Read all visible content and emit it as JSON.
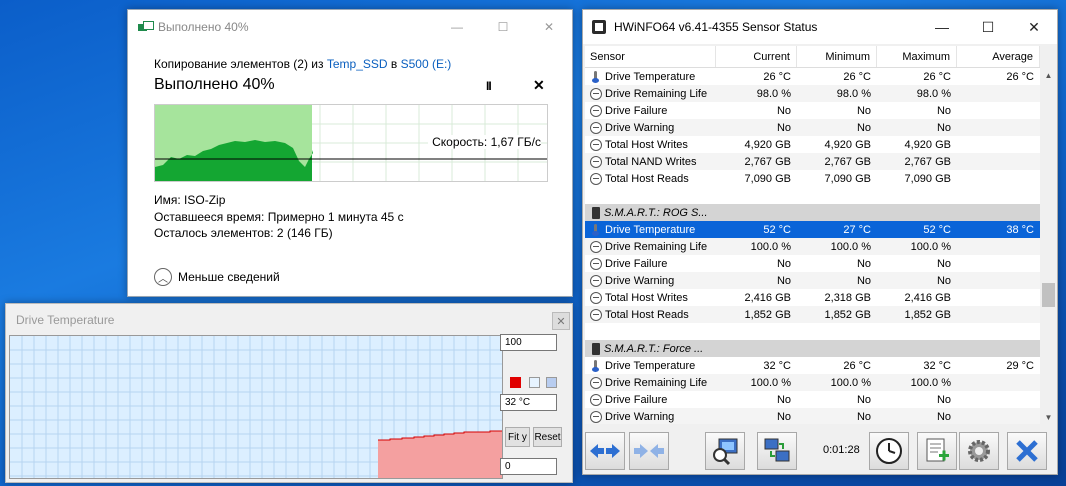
{
  "copy_dialog": {
    "title": "Выполнено 40%",
    "line_prefix": "Копирование элементов (2) из",
    "source": "Temp_SSD",
    "line_mid": "в",
    "dest": "S500 (E:)",
    "heading": "Выполнено 40%",
    "progress_fraction": 0.4,
    "speed": "Скорость: 1,67 ГБ/с",
    "name_line": "Имя:  ISO-Zip",
    "time_line": "Оставшееся время:  Примерно 1 минута 45 с",
    "items_line": "Осталось элементов:  2 (146 ГБ)",
    "less_details": "Меньше сведений",
    "pause_glyph": "II",
    "close_glyph": "✕",
    "accent": "#06b025"
  },
  "temp_graph": {
    "title": "Drive Temperature",
    "max_value": "100",
    "current_value": "32 °C",
    "min_value": "0",
    "fit_label": "Fit y",
    "reset_label": "Reset",
    "fill_color": "#f4a0a0",
    "line_color": "#d60000"
  },
  "hwinfo": {
    "title": "HWiNFO64 v6.41-4355 Sensor Status",
    "columns": [
      "Sensor",
      "Current",
      "Minimum",
      "Maximum",
      "Average"
    ],
    "rows": [
      {
        "type": "thermo",
        "name": "Drive Temperature",
        "cur": "26 °C",
        "min": "26 °C",
        "max": "26 °C",
        "avg": "26 °C"
      },
      {
        "type": "circle",
        "name": "Drive Remaining Life",
        "cur": "98.0 %",
        "min": "98.0 %",
        "max": "98.0 %",
        "avg": ""
      },
      {
        "type": "circle",
        "name": "Drive Failure",
        "cur": "No",
        "min": "No",
        "max": "No",
        "avg": ""
      },
      {
        "type": "circle",
        "name": "Drive Warning",
        "cur": "No",
        "min": "No",
        "max": "No",
        "avg": ""
      },
      {
        "type": "circle",
        "name": "Total Host Writes",
        "cur": "4,920 GB",
        "min": "4,920 GB",
        "max": "4,920 GB",
        "avg": ""
      },
      {
        "type": "circle",
        "name": "Total NAND Writes",
        "cur": "2,767 GB",
        "min": "2,767 GB",
        "max": "2,767 GB",
        "avg": ""
      },
      {
        "type": "circle",
        "name": "Total Host Reads",
        "cur": "7,090 GB",
        "min": "7,090 GB",
        "max": "7,090 GB",
        "avg": ""
      },
      {
        "type": "blank"
      },
      {
        "type": "group",
        "name": "S.M.A.R.T.: ROG S..."
      },
      {
        "type": "thermo",
        "name": "Drive Temperature",
        "cur": "52 °C",
        "min": "27 °C",
        "max": "52 °C",
        "avg": "38 °C",
        "selected": true
      },
      {
        "type": "circle",
        "name": "Drive Remaining Life",
        "cur": "100.0 %",
        "min": "100.0 %",
        "max": "100.0 %",
        "avg": ""
      },
      {
        "type": "circle",
        "name": "Drive Failure",
        "cur": "No",
        "min": "No",
        "max": "No",
        "avg": ""
      },
      {
        "type": "circle",
        "name": "Drive Warning",
        "cur": "No",
        "min": "No",
        "max": "No",
        "avg": ""
      },
      {
        "type": "circle",
        "name": "Total Host Writes",
        "cur": "2,416 GB",
        "min": "2,318 GB",
        "max": "2,416 GB",
        "avg": ""
      },
      {
        "type": "circle",
        "name": "Total Host Reads",
        "cur": "1,852 GB",
        "min": "1,852 GB",
        "max": "1,852 GB",
        "avg": ""
      },
      {
        "type": "blank"
      },
      {
        "type": "group",
        "name": "S.M.A.R.T.: Force ..."
      },
      {
        "type": "thermo",
        "name": "Drive Temperature",
        "cur": "32 °C",
        "min": "26 °C",
        "max": "32 °C",
        "avg": "29 °C"
      },
      {
        "type": "circle",
        "name": "Drive Remaining Life",
        "cur": "100.0 %",
        "min": "100.0 %",
        "max": "100.0 %",
        "avg": ""
      },
      {
        "type": "circle",
        "name": "Drive Failure",
        "cur": "No",
        "min": "No",
        "max": "No",
        "avg": ""
      },
      {
        "type": "circle",
        "name": "Drive Warning",
        "cur": "No",
        "min": "No",
        "max": "No",
        "avg": ""
      }
    ],
    "timer": "0:01:28",
    "toolbar_icons": [
      "expand-arrows-icon",
      "collapse-arrows-icon",
      "sensor-settings-icon",
      "network-icon",
      "clock-icon",
      "log-add-icon",
      "gear-icon",
      "exit-icon"
    ],
    "selection_color": "#0a64d8"
  }
}
